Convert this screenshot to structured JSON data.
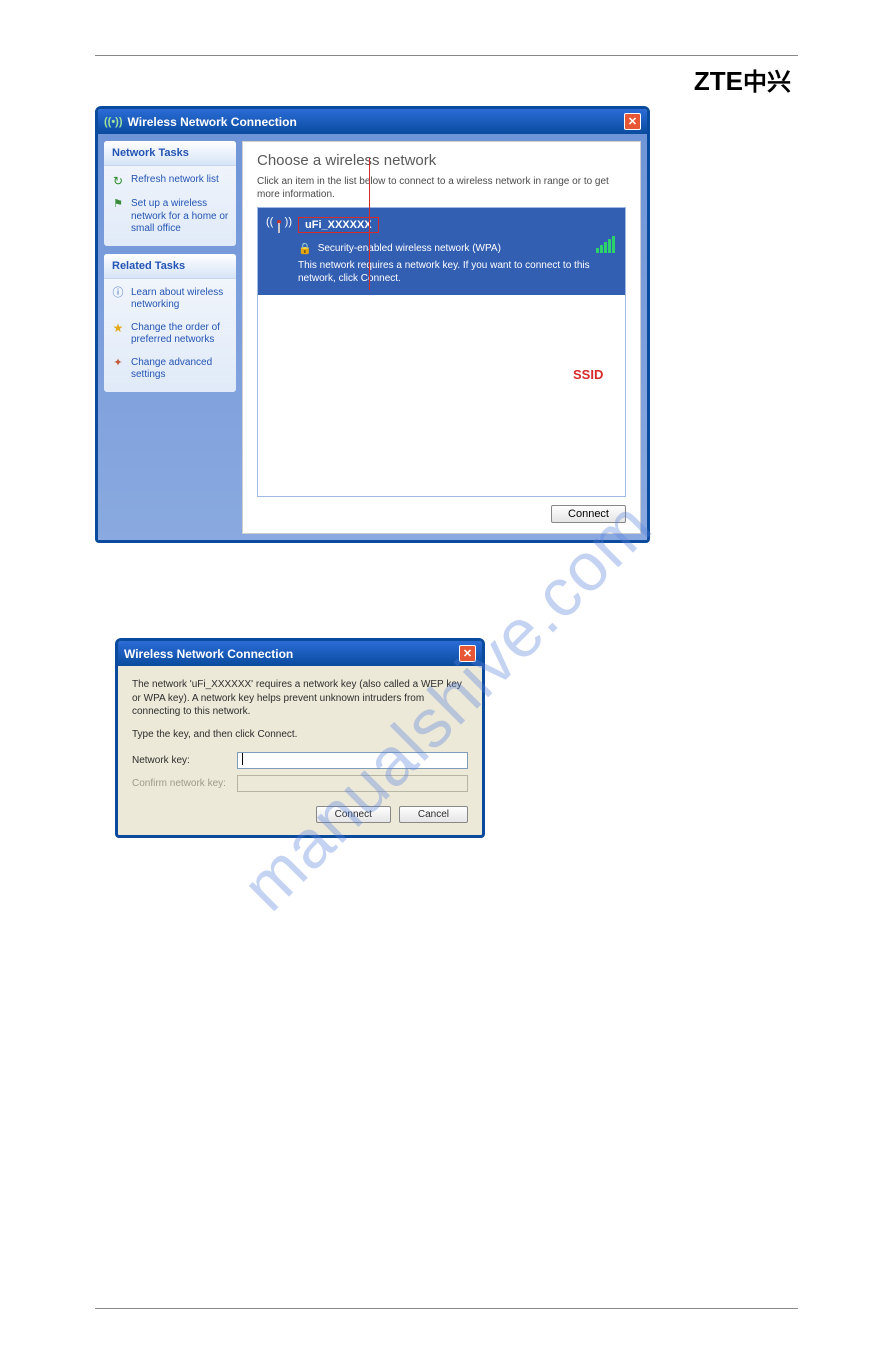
{
  "logo_latin": "ZTE",
  "logo_cn": "中兴",
  "watermark": "manualshive.com",
  "win1": {
    "title": "Wireless Network Connection",
    "main_title": "Choose a wireless network",
    "main_sub": "Click an item in the list below to connect to a wireless network in range or to get more information.",
    "connect_btn": "Connect",
    "sidebar": {
      "net_tasks_h": "Network Tasks",
      "refresh": "Refresh network list",
      "setup": "Set up a wireless network for a home or small office",
      "related_h": "Related Tasks",
      "learn": "Learn about wireless networking",
      "order": "Change the order of preferred networks",
      "advanced": "Change advanced settings"
    },
    "net_item": {
      "ssid": "uFi_XXXXXX",
      "sec": "Security-enabled wireless network (WPA)",
      "desc": "This network requires a network key. If you want to connect to this network, click Connect."
    },
    "ssid_label": "SSID"
  },
  "win2": {
    "title": "Wireless Network Connection",
    "msg": "The network 'uFi_XXXXXX' requires a network key (also called a WEP key or WPA key). A network key helps prevent unknown intruders from connecting to this network.",
    "type_msg": "Type the key, and then click Connect.",
    "label_key": "Network key:",
    "label_confirm": "Confirm network key:",
    "btn_connect": "Connect",
    "btn_cancel": "Cancel"
  }
}
